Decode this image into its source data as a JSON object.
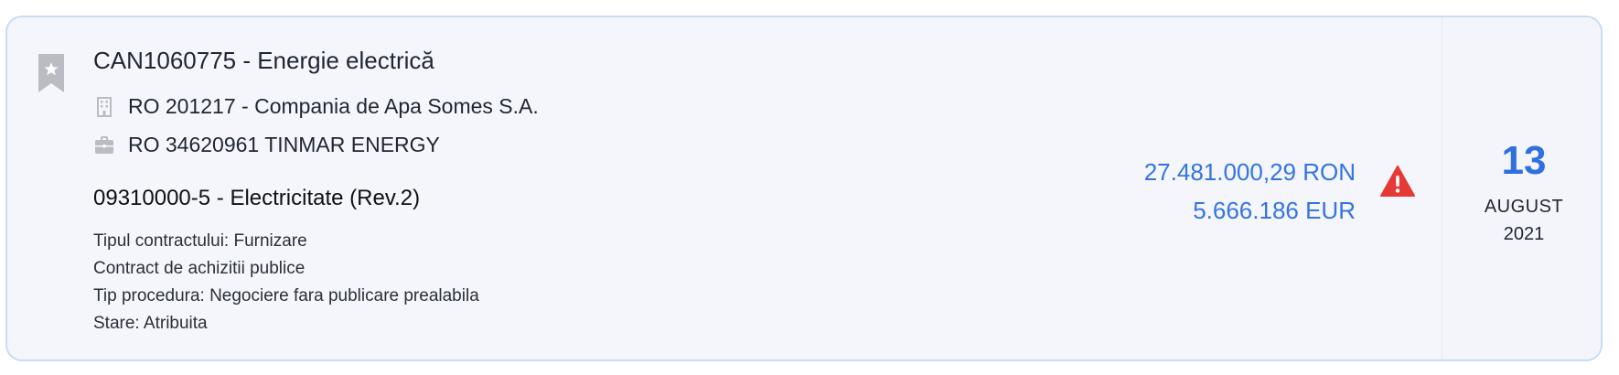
{
  "notice": {
    "title": "CAN1060775 - Energie electrică",
    "authority": "RO 201217 - Compania de Apa Somes S.A.",
    "supplier": "RO 34620961 TINMAR ENERGY",
    "cpv": "09310000-5 - Electricitate (Rev.2)",
    "details": {
      "contract_type": "Tipul contractului: Furnizare",
      "contract_kind": "Contract de achizitii publice",
      "procedure": "Tip procedura: Negociere fara publicare prealabila",
      "status_label": "Stare: ",
      "status_value": "Atribuita"
    },
    "amount_ron": "27.481.000,29 RON",
    "amount_eur": "5.666.186 EUR",
    "date": {
      "day": "13",
      "month": "AUGUST",
      "year": "2021"
    }
  },
  "icons": {
    "bookmark": "bookmark-star-icon",
    "authority": "building-icon",
    "supplier": "briefcase-icon",
    "warning": "warning-triangle-icon"
  },
  "colors": {
    "accent_blue": "#3574e3",
    "warning_red": "#e53935",
    "card_border": "#c7dcf5",
    "card_bg": "#f4f6fb",
    "icon_gray": "#b9bcc2"
  }
}
